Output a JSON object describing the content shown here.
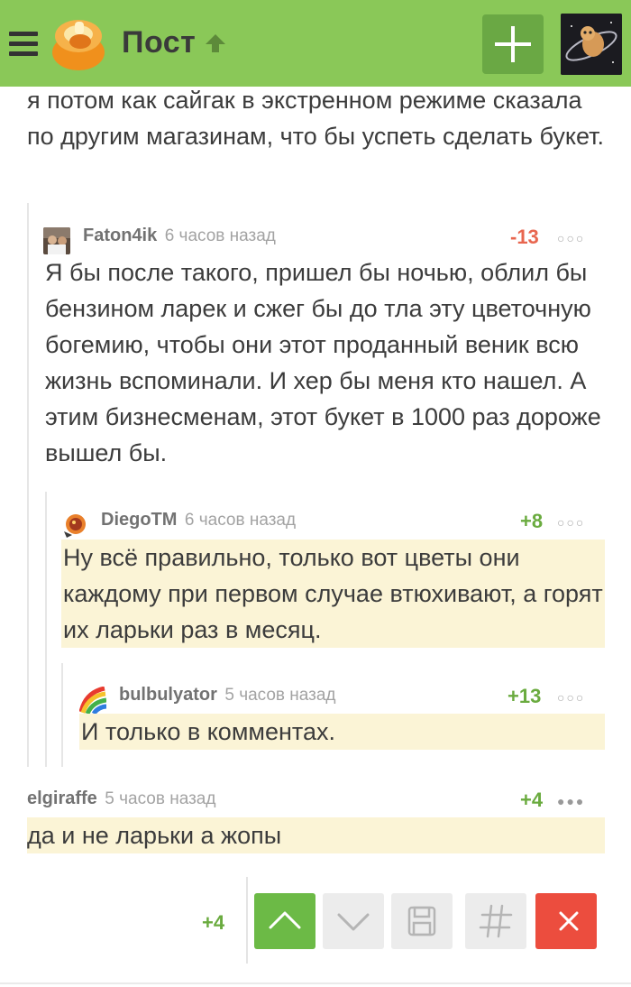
{
  "header": {
    "title": "Пост",
    "menu_icon": "hamburger-icon",
    "logo": "cupcake-logo",
    "up_icon": "arrow-up-icon",
    "add_icon": "plus-icon",
    "accent": "#8ac858"
  },
  "top_text": "я потом как сайгак в экстренном режиме сказала по другим магазинам, что бы успеть сделать букет.",
  "comments": [
    {
      "user": "Faton4ik",
      "time": "6 часов назад",
      "rating": "-13",
      "rating_color": "#e8664f",
      "dots": "○○○",
      "text": "Я бы после такого, пришел бы ночью, облил бы бензином ларек и сжег бы до тла эту цветочную богемию, чтобы они этот проданный веник всю жизнь вспоминали. И хер бы меня кто нашел. А этим бизнесменам, этот букет в 1000 раз дороже вышел бы."
    },
    {
      "user": "DiegoTM",
      "time": "6 часов назад",
      "rating": "+8",
      "rating_color": "#6aab3f",
      "dots": "○○○",
      "text": "Ну всё правильно, только вот цветы они каждому при первом случае втюхивают, а горят их ларьки раз в месяц."
    },
    {
      "user": "bulbulyator",
      "time": "5 часов назад",
      "rating": "+13",
      "rating_color": "#6aab3f",
      "dots": "○○○",
      "text": "И только в комментах."
    },
    {
      "user": "elgiraffe",
      "time": "5 часов назад",
      "rating": "+4",
      "rating_color": "#6aab3f",
      "dots": "●●●",
      "text": "да и не ларьки а жопы"
    }
  ],
  "actions": {
    "score": "+4",
    "up_icon": "chevron-up-icon",
    "down_icon": "chevron-down-icon",
    "save_icon": "floppy-disk-icon",
    "tag_icon": "hash-icon",
    "close_icon": "close-icon"
  }
}
